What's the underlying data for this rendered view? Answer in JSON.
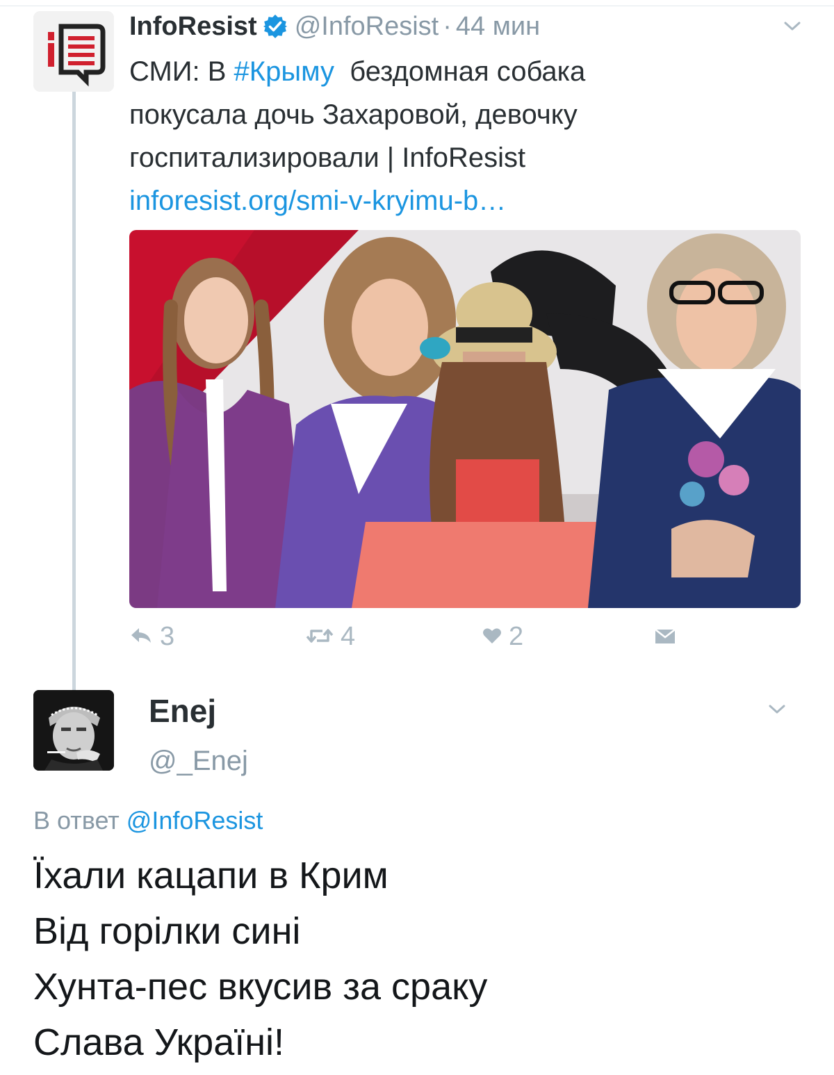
{
  "tweet1": {
    "author_name": "InfoResist",
    "verified": true,
    "handle": "@InfoResist",
    "separator": "·",
    "time": "44 мин",
    "text_before": "СМИ: В ",
    "hashtag": "#Крыму",
    "text_after": "  бездомная собака",
    "line2": "покусала дочь Захаровой, девочку",
    "line3": "госпитализировали | InfoResist",
    "link": "inforesist.org/smi-v-kryimu-b…",
    "actions": {
      "replies": "3",
      "retweets": "4",
      "likes": "2"
    }
  },
  "tweet2": {
    "author_name": "Enej",
    "handle": "@_Enej",
    "reply_prefix": "В ответ ",
    "reply_mention": "@InfoResist",
    "lines": [
      "Їхали кацапи в Крим",
      "Від горілки сині",
      "Хунта-пес вкусив за сраку",
      "Слава Україні!"
    ]
  },
  "colors": {
    "link_blue": "#1b95e0",
    "muted_gray": "#8899a6",
    "icon_gray": "#aab8c2",
    "thread_line": "#ccd6dd",
    "logo_red": "#d0202e"
  },
  "icons": {
    "verified": "verified-badge-icon",
    "menu": "chevron-down-icon",
    "reply": "reply-icon",
    "retweet": "retweet-icon",
    "like": "heart-icon",
    "dm": "direct-message-icon"
  }
}
